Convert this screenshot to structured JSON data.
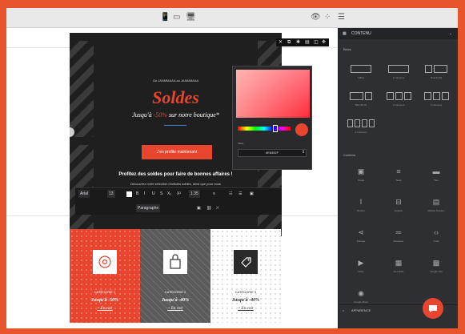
{
  "topbar": {
    "icons": {
      "mobile": "📱",
      "tablet": "▭",
      "desktop": "🖥",
      "preview": "👁",
      "grid": "⁘",
      "settings": "☰"
    }
  },
  "email": {
    "preheader": "Ou JANMMAAA au JANMMAAA",
    "title": "Soldes",
    "subtitle_prefix": "Jusqu'à ",
    "subtitle_pct": "-50%",
    "subtitle_suffix": " sur notre boutique*",
    "cta": "J'en profite maintenant",
    "promo": "Profitez des soldes pour faire de bonnes affaires !",
    "promo_sub": "Découvrez notre sélection d'articles soldés, ainsi que pour nous"
  },
  "color_picker": {
    "format_label": "Value",
    "hex": "#E8452F",
    "selected_color": "#e8452f"
  },
  "editor_toolbar": {
    "font": "Arial",
    "size": "13",
    "line_height": "1.35",
    "format": "Paragraphe",
    "buttons": [
      "B",
      "I",
      "U",
      "S",
      "X₂",
      "X²"
    ]
  },
  "categories": [
    {
      "label": "CATÉGORIE 1",
      "offer": "Jusqu'à -50%",
      "link": "> En voir",
      "bg": "#e8452f",
      "fg": "#ffffff",
      "icon": "bullseye-icon"
    },
    {
      "label": "CATÉGORIE 2",
      "offer": "Jusqu'à -40%",
      "link": "> En voir",
      "bg": "#5a5a5b",
      "fg": "#ffffff",
      "icon": "shopping-bag-icon"
    },
    {
      "label": "CATÉGORIE 3",
      "offer": "Jusqu'à -40%",
      "link": "> En voir",
      "bg": "#ffffff",
      "fg": "#2e2e2e",
      "icon": "tag-icon"
    }
  ],
  "panel": {
    "header": "CONTENU",
    "blocks_label": "Blocs",
    "blocks": [
      "1 Bloc",
      "2 colonnes",
      "Oral 33-66",
      "Bloc 66-33",
      "3 colonnes",
      "3 colonnes",
      "4 colonnes"
    ],
    "content_label": "Contenu",
    "content": [
      {
        "label": "Image",
        "glyph": "▣"
      },
      {
        "label": "Texte",
        "glyph": "≡"
      },
      {
        "label": "Titre",
        "glyph": "▬"
      },
      {
        "label": "Bouton",
        "glyph": "I"
      },
      {
        "label": "Séparat.",
        "glyph": "⊟"
      },
      {
        "label": "Médias Sociaux",
        "glyph": "▤"
      },
      {
        "label": "Partage",
        "glyph": "⋖"
      },
      {
        "label": "Espaceur",
        "glyph": "═"
      },
      {
        "label": "Code",
        "glyph": "‹›"
      },
      {
        "label": "Vidéo",
        "glyph": "▶"
      },
      {
        "label": "Flux RSS",
        "glyph": "▦"
      },
      {
        "label": "Google Ads",
        "glyph": "▩"
      },
      {
        "label": "Google Maps",
        "glyph": "◉"
      }
    ],
    "appearance": "APPARENCE"
  },
  "colors": {
    "brand": "#e8452f",
    "frame": "#e8552d",
    "panel": "#2e2f33"
  }
}
